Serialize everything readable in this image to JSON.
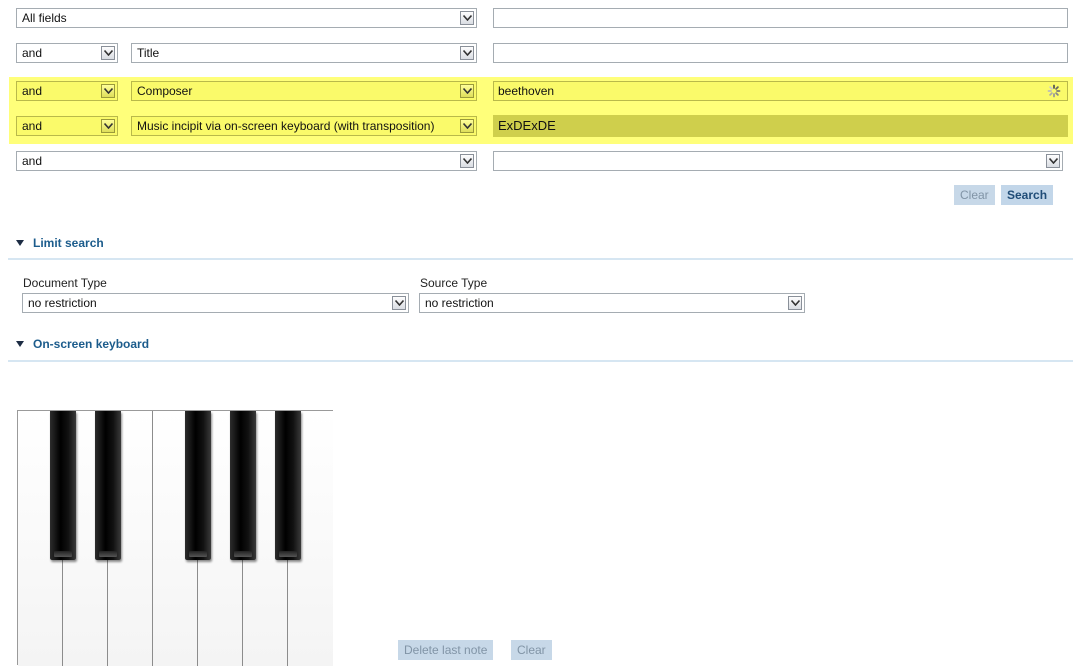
{
  "search_rows": [
    {
      "field": "All fields",
      "value": ""
    },
    {
      "operator": "and",
      "field": "Title",
      "value": ""
    },
    {
      "operator": "and",
      "field": "Composer",
      "value": "beethoven"
    },
    {
      "operator": "and",
      "field": "Music incipit via on-screen keyboard (with transposition)",
      "value": "ExDExDE"
    },
    {
      "operator": "and",
      "field": "",
      "value": ""
    }
  ],
  "buttons": {
    "clear": "Clear",
    "search": "Search"
  },
  "limit_search": {
    "title": "Limit search",
    "document_type": {
      "label": "Document Type",
      "value": "no restriction"
    },
    "source_type": {
      "label": "Source Type",
      "value": "no restriction"
    }
  },
  "keyboard": {
    "title": "On-screen keyboard",
    "delete_last_note": "Delete last note",
    "clear": "Clear"
  },
  "colors": {
    "highlight": "#ffff7a",
    "section_title": "#1c5c8c",
    "button_bg": "#c7d8e8"
  }
}
